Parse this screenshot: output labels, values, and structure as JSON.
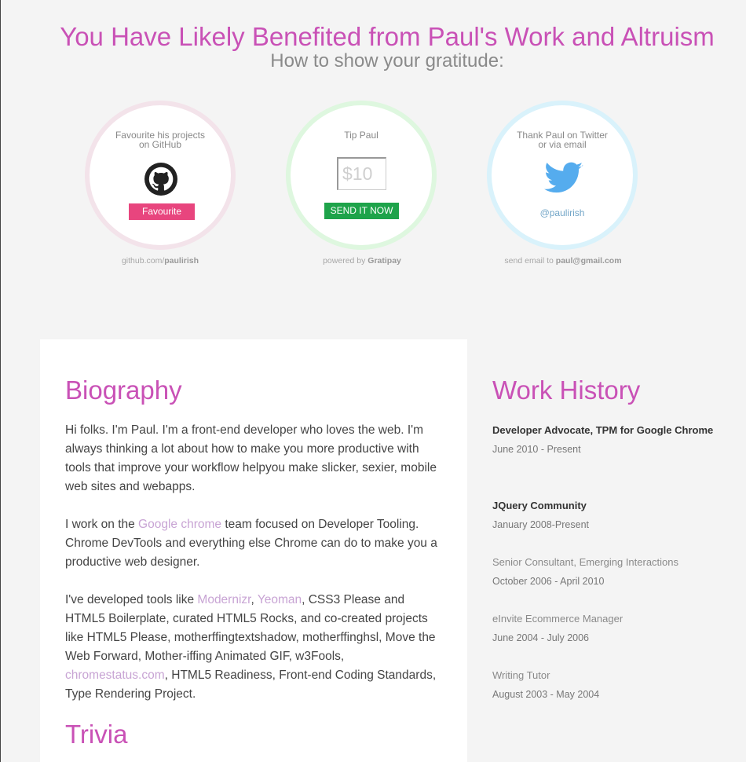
{
  "hero": {
    "title": "You Have Likely Benefited from Paul's Work and Altruism",
    "subtitle": "How to show your gratitude:"
  },
  "cards": {
    "github": {
      "label": "Favourite his projects on GitHub",
      "button": "Favourite",
      "caption_prefix": "github.com/",
      "caption_bold": "paulirish",
      "icon": "github-icon"
    },
    "tip": {
      "label": "Tip Paul",
      "amount": "$10",
      "button": "SEND IT NOW",
      "caption_prefix": "powered by ",
      "caption_bold": "Gratipay"
    },
    "twitter": {
      "label": "Thank Paul on Twitter or via email",
      "handle": "@paulirish",
      "caption_prefix": "send email to ",
      "caption_bold": "paul@gmail.com",
      "icon": "twitter-icon"
    }
  },
  "biography": {
    "title": "Biography",
    "p1": "Hi folks. I'm Paul. I'm a front-end developer who loves the web. I'm always thinking a lot about how to make you more productive with tools that improve your workflow helpyou make slicker, sexier, mobile web sites and webapps.",
    "p2_before": "I work on the ",
    "p2_link": "Google chrome",
    "p2_after": " team focused on Developer Tooling. Chrome DevTools and everything else Chrome can do to make you a productive web designer.",
    "p3_before": "I've developed tools like ",
    "p3_link1": "Modernizr",
    "p3_sep": ", ",
    "p3_link2": "Yeoman",
    "p3_mid": ", CSS3 Please and HTML5 Boilerplate, curated HTML5 Rocks, and co-created projects like HTML5 Please, motherffingtextshadow, motherffinghsl, Move the Web Forward, Mother-iffing Animated GIF, w3Fools, ",
    "p3_link3": "chromestatus.com",
    "p3_after": ", HTML5 Readiness, Front-end Coding Standards, Type Rendering Project."
  },
  "trivia": {
    "title": "Trivia"
  },
  "work_history": {
    "title": "Work History",
    "jobs": [
      {
        "role": "Developer Advocate, TPM for Google Chrome",
        "dates": "June 2010 - Present"
      },
      {
        "role": "JQuery Community",
        "dates": "January 2008-Present"
      },
      {
        "role": "Senior Consultant, Emerging Interactions",
        "dates": "October 2006 - April 2010"
      },
      {
        "role": "eInvite Ecommerce Manager",
        "dates": "June 2004 - July 2006"
      },
      {
        "role": "Writing Tutor",
        "dates": "August 2003 - May 2004"
      }
    ]
  },
  "colors": {
    "accent": "#c951b6",
    "favourite_button": "#e8457e",
    "send_button": "#1ea34a",
    "twitter": "#55acee"
  }
}
